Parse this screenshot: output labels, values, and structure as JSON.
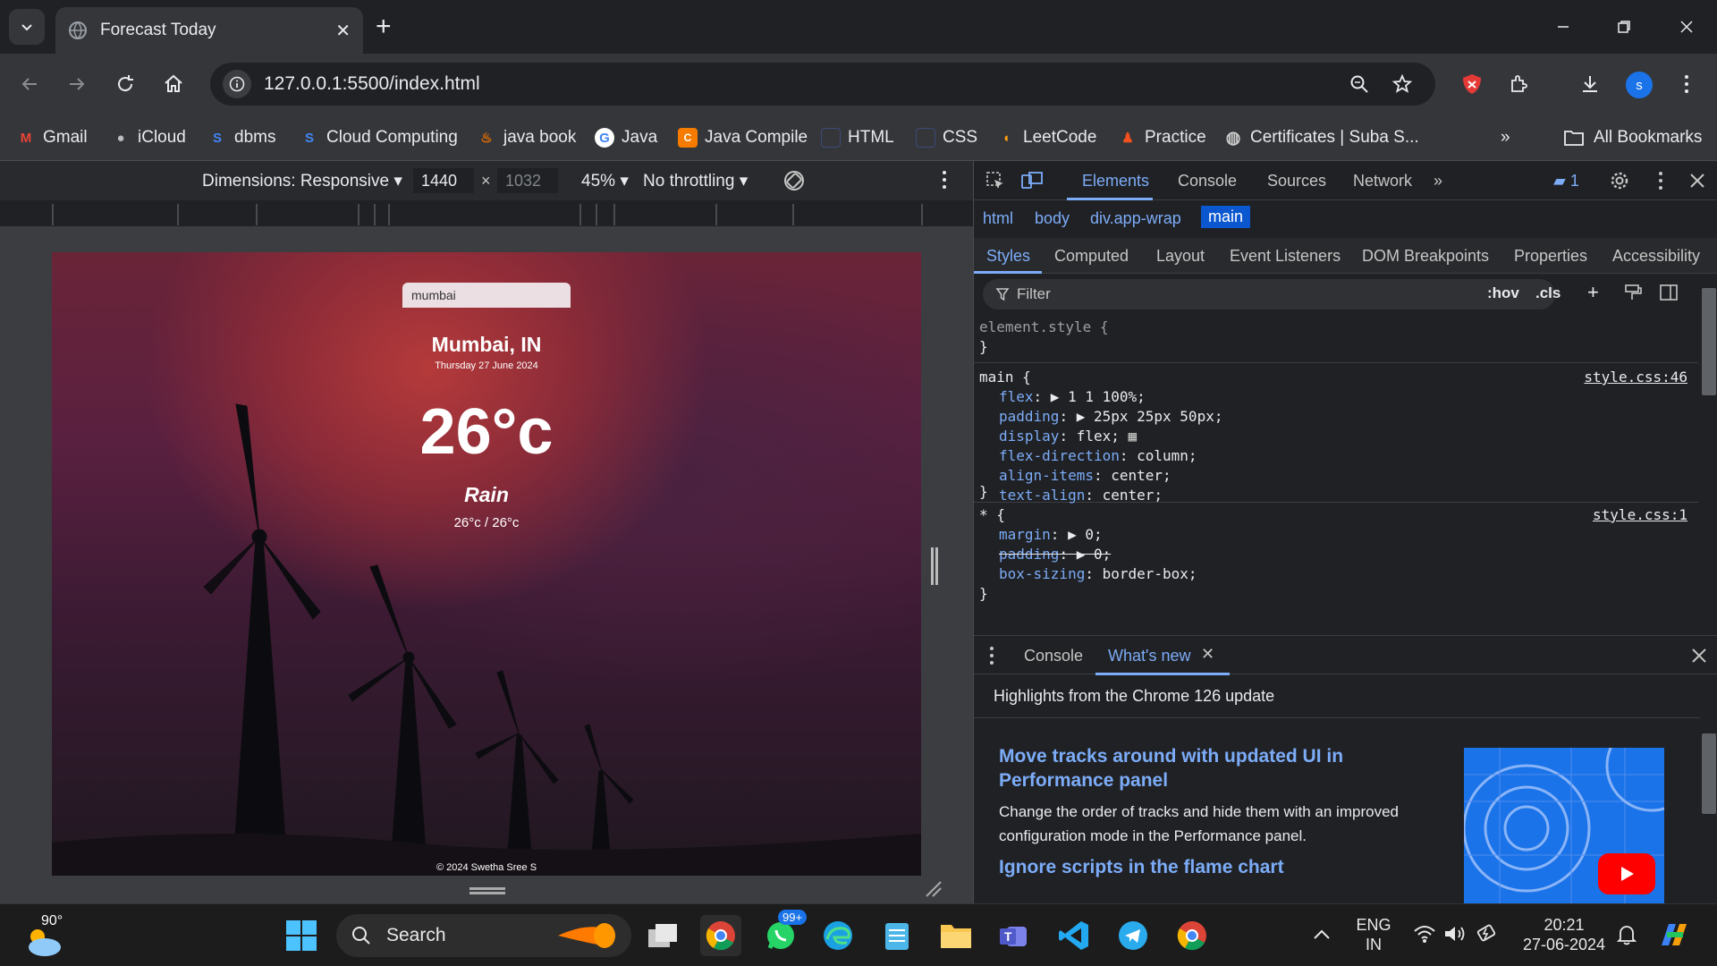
{
  "browser": {
    "tab_title": "Forecast Today",
    "url": "127.0.0.1:5500/index.html",
    "profile_initial": "s",
    "bookmarks": [
      {
        "label": "Gmail",
        "icon": "gmail-icon"
      },
      {
        "label": "iCloud",
        "icon": "apple-icon"
      },
      {
        "label": "dbms",
        "icon": "s-icon"
      },
      {
        "label": "Cloud Computing",
        "icon": "s-icon"
      },
      {
        "label": "java book",
        "icon": "java-icon"
      },
      {
        "label": "Java",
        "icon": "google-icon"
      },
      {
        "label": "Java Compile",
        "icon": "compiler-icon"
      },
      {
        "label": "HTML",
        "icon": "page-icon"
      },
      {
        "label": "CSS",
        "icon": "page-icon"
      },
      {
        "label": "LeetCode",
        "icon": "leetcode-icon"
      },
      {
        "label": "Practice",
        "icon": "practice-icon"
      },
      {
        "label": "Certificates | Suba S...",
        "icon": "globe-icon"
      }
    ],
    "all_bookmarks": "All Bookmarks"
  },
  "device_toolbar": {
    "dimensions": "Dimensions: Responsive",
    "width": "1440",
    "times": "×",
    "height": "1032",
    "zoom": "45%",
    "throttling": "No throttling"
  },
  "app": {
    "search_value": "mumbai",
    "city": "Mumbai, IN",
    "date": "Thursday 27 June 2024",
    "temperature": "26°c",
    "condition": "Rain",
    "range": "26°c / 26°c",
    "footer": "© 2024 Swetha Sree S"
  },
  "devtools": {
    "tabs": [
      "Elements",
      "Console",
      "Sources",
      "Network"
    ],
    "issues_count": "1",
    "breadcrumbs": [
      "html",
      "body",
      "div.app-wrap",
      "main"
    ],
    "subtabs": [
      "Styles",
      "Computed",
      "Layout",
      "Event Listeners",
      "DOM Breakpoints",
      "Properties",
      "Accessibility"
    ],
    "filter_placeholder": "Filter",
    "hov": ":hov",
    "cls": ".cls",
    "styles": {
      "element_style_open": "element.style {",
      "close": "}",
      "main_selector": "main {",
      "main_source": "style.css:46",
      "main_props": [
        {
          "name": "flex",
          "value": "▶ 1 1 100%;"
        },
        {
          "name": "padding",
          "value": "▶ 25px 25px 50px;"
        },
        {
          "name": "display",
          "value": "flex;"
        },
        {
          "name": "flex-direction",
          "value": "column;"
        },
        {
          "name": "align-items",
          "value": "center;"
        },
        {
          "name": "text-align",
          "value": "center;"
        }
      ],
      "star_selector": "* {",
      "star_source": "style.css:1",
      "star_props": [
        {
          "name": "margin",
          "value": "▶ 0;"
        },
        {
          "name": "padding",
          "value": "▶ 0;"
        },
        {
          "name": "box-sizing",
          "value": "border-box;"
        }
      ]
    },
    "drawer": {
      "tabs": [
        "Console",
        "What's new"
      ],
      "highlights": "Highlights from the Chrome 126 update",
      "heading1": "Move tracks around with updated UI in Performance panel",
      "para1": "Change the order of tracks and hide them with an improved configuration mode in the Performance panel.",
      "heading2": "Ignore scripts in the flame chart"
    }
  },
  "taskbar": {
    "weather_temp": "90°",
    "search_label": "Search",
    "whatsapp_badge": "99+",
    "lang_line1": "ENG",
    "lang_line2": "IN",
    "time": "20:21",
    "date": "27-06-2024"
  },
  "colors": {
    "accent": "#7cacf8",
    "selected_crumb": "#0b57d0",
    "profile": "#1a73e8"
  }
}
